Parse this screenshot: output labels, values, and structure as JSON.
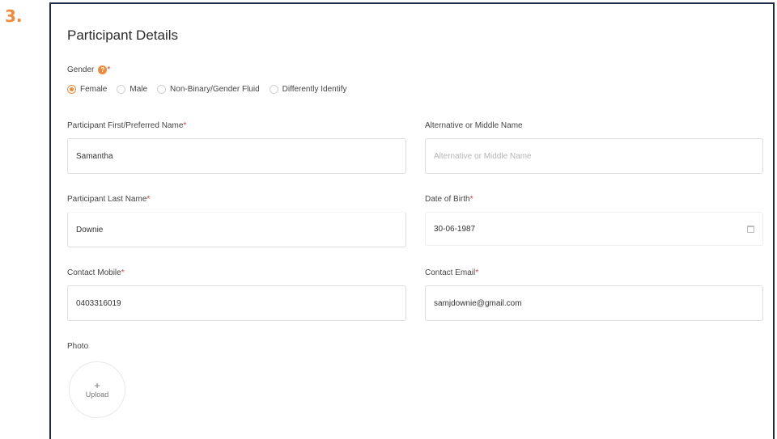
{
  "step": "3.",
  "section_title": "Participant Details",
  "gender": {
    "label": "Gender",
    "required_mark": "*",
    "help_icon": "help-icon",
    "options": [
      "Female",
      "Male",
      "Non-Binary/Gender Fluid",
      "Differently Identify"
    ],
    "selected": "Female"
  },
  "fields": {
    "first_name": {
      "label": "Participant First/Preferred Name",
      "required": "*",
      "value": "Samantha"
    },
    "middle_name": {
      "label": "Alternative or Middle Name",
      "placeholder": "Alternative or Middle Name"
    },
    "last_name": {
      "label": "Participant Last Name",
      "required": "*",
      "value": "Downie"
    },
    "dob": {
      "label": "Date of Birth",
      "required": "*",
      "value": "30-06-1987",
      "icon": "calendar-icon"
    },
    "mobile": {
      "label": "Contact Mobile",
      "required": "*",
      "value": "0403316019"
    },
    "email": {
      "label": "Contact Email",
      "required": "*",
      "value": "samjdownie@gmail.com"
    }
  },
  "photo": {
    "label": "Photo",
    "upload_symbol": "+",
    "upload_label": "Upload"
  },
  "colors": {
    "accent": "#f08a3a",
    "required": "#e53935",
    "frame_border": "#1e2a4a"
  }
}
